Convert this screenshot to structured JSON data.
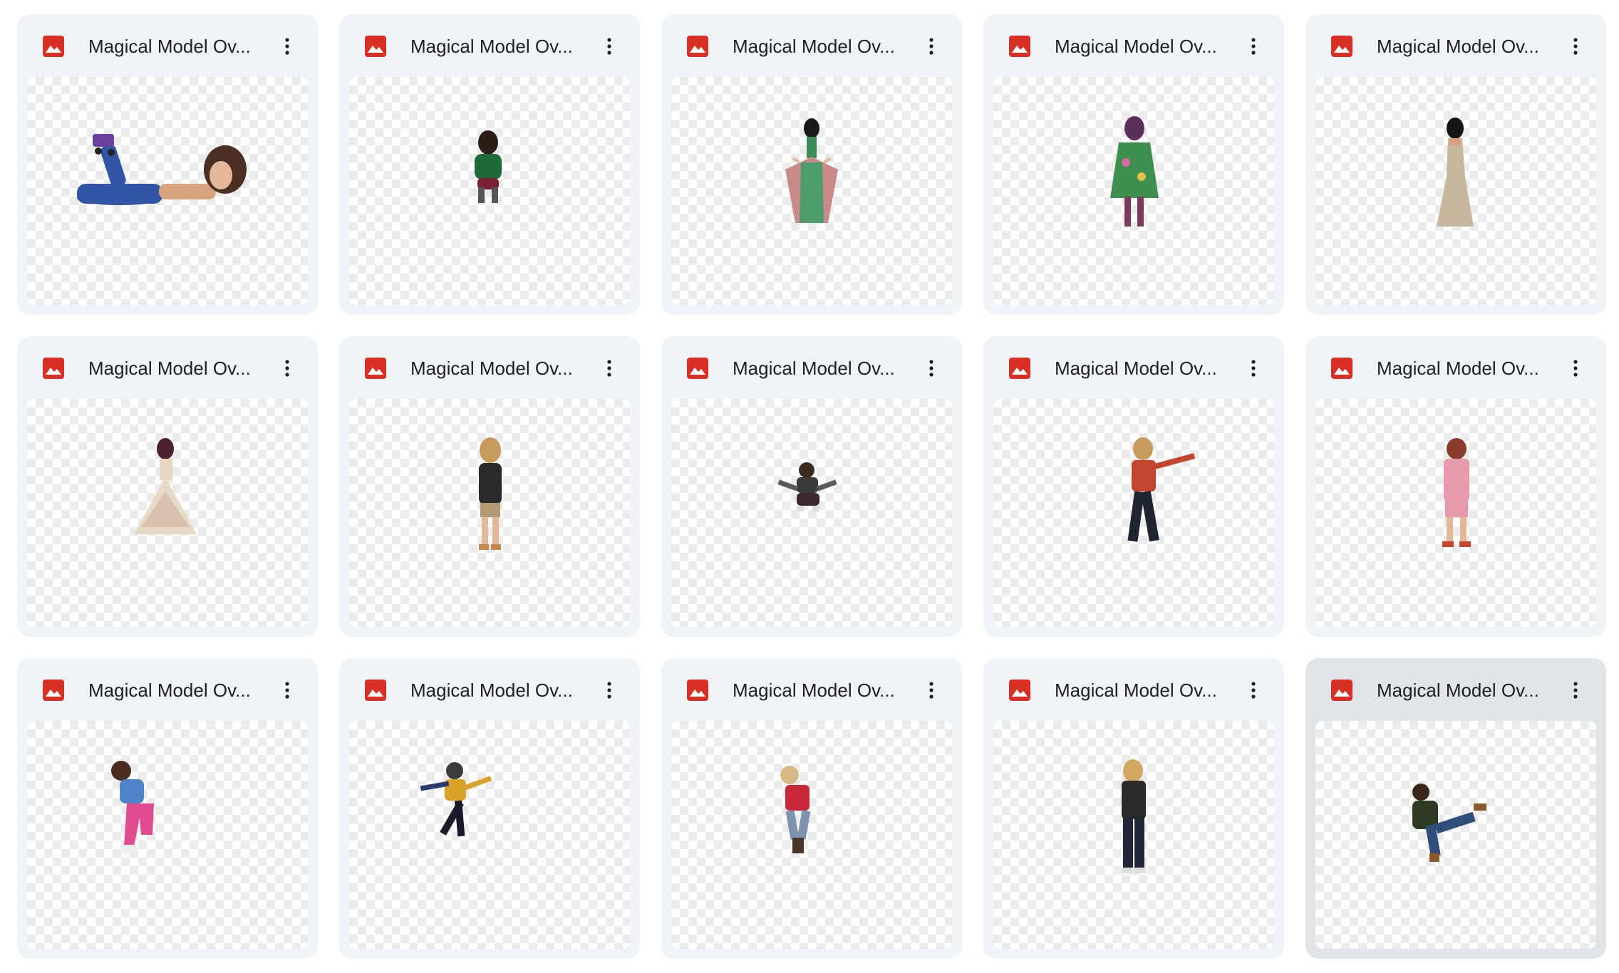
{
  "colors": {
    "card_bg": "#f0f4f9",
    "card_selected_bg": "#e1e5ea",
    "image_icon": "#d93025",
    "title_text": "#1f1f1f"
  },
  "files": [
    {
      "title": "Magical Model Ov...",
      "icon": "image-file-icon",
      "subject": "girl lying on stomach in jeans with roller skates"
    },
    {
      "title": "Magical Model Ov...",
      "icon": "image-file-icon",
      "subject": "girl crouching in green jacket"
    },
    {
      "title": "Magical Model Ov...",
      "icon": "image-file-icon",
      "subject": "woman holding out long striped dress"
    },
    {
      "title": "Magical Model Ov...",
      "icon": "image-file-icon",
      "subject": "woman in green floral dress"
    },
    {
      "title": "Magical Model Ov...",
      "icon": "image-file-icon",
      "subject": "woman in beige evening gown"
    },
    {
      "title": "Magical Model Ov...",
      "icon": "image-file-icon",
      "subject": "girl in tiered tulle gown"
    },
    {
      "title": "Magical Model Ov...",
      "icon": "image-file-icon",
      "subject": "boy in dark jacket and shorts"
    },
    {
      "title": "Magical Model Ov...",
      "icon": "image-file-icon",
      "subject": "boy jumping in crouch"
    },
    {
      "title": "Magical Model Ov...",
      "icon": "image-file-icon",
      "subject": "boy in plaid shirt pointing"
    },
    {
      "title": "Magical Model Ov...",
      "icon": "image-file-icon",
      "subject": "boy in pink suit"
    },
    {
      "title": "Magical Model Ov...",
      "icon": "image-file-icon",
      "subject": "boy jumping in pink pants"
    },
    {
      "title": "Magical Model Ov...",
      "icon": "image-file-icon",
      "subject": "boy leaping in striped sweater"
    },
    {
      "title": "Magical Model Ov...",
      "icon": "image-file-icon",
      "subject": "boy jumping in red plaid shirt"
    },
    {
      "title": "Magical Model Ov...",
      "icon": "image-file-icon",
      "subject": "boy looking down in black shirt"
    },
    {
      "title": "Magical Model Ov...",
      "icon": "image-file-icon",
      "subject": "man sitting in green jacket",
      "selected": true
    }
  ]
}
